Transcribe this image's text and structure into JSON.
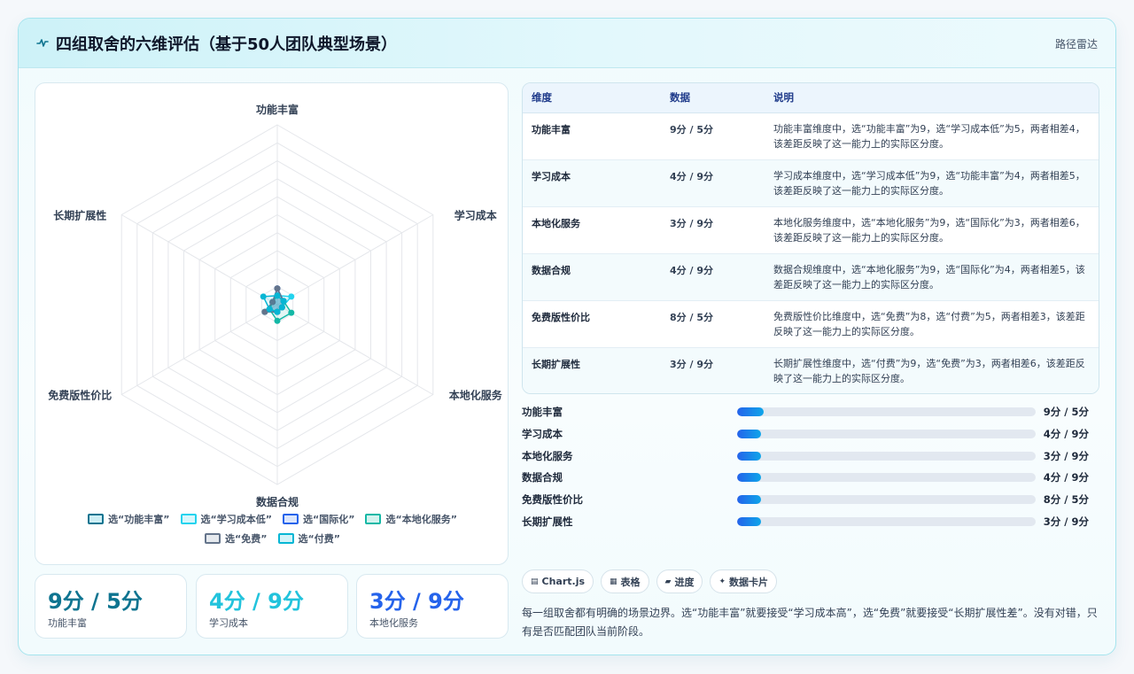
{
  "header": {
    "title": "四组取舍的六维评估（基于50人团队典型场景）",
    "badge": "路径雷达",
    "icon": "pulse-icon"
  },
  "chart_data": {
    "type": "radar",
    "axes": [
      "功能丰富",
      "学习成本",
      "本地化服务",
      "数据合规",
      "免费版性价比",
      "长期扩展性"
    ],
    "max": 100,
    "series": [
      {
        "name": "选“功能丰富”",
        "color": "#0e7490",
        "values": [
          9,
          4,
          3,
          4,
          8,
          3
        ]
      },
      {
        "name": "选“学习成本低”",
        "color": "#22d3ee",
        "values": [
          5,
          9,
          3,
          4,
          8,
          3
        ]
      },
      {
        "name": "选“国际化”",
        "color": "#2563eb",
        "values": [
          9,
          4,
          3,
          4,
          5,
          3
        ]
      },
      {
        "name": "选“本地化服务”",
        "color": "#14b8a6",
        "values": [
          5,
          4,
          9,
          9,
          5,
          3
        ]
      },
      {
        "name": "选“免费”",
        "color": "#64748b",
        "values": [
          9,
          4,
          3,
          4,
          8,
          3
        ]
      },
      {
        "name": "选“付费”",
        "color": "#06b6d4",
        "values": [
          5,
          4,
          3,
          4,
          5,
          9
        ]
      }
    ]
  },
  "stats": [
    {
      "value": "9分 / 5分",
      "label": "功能丰富",
      "color": "#0e7490"
    },
    {
      "value": "4分 / 9分",
      "label": "学习成本",
      "color": "#22c3dc"
    },
    {
      "value": "3分 / 9分",
      "label": "本地化服务",
      "color": "#2563eb"
    }
  ],
  "table": {
    "headers": [
      "维度",
      "数据",
      "说明"
    ],
    "rows": [
      [
        "功能丰富",
        "9分 / 5分",
        "功能丰富维度中，选“功能丰富”为9，选“学习成本低”为5，两者相差4，该差距反映了这一能力上的实际区分度。"
      ],
      [
        "学习成本",
        "4分 / 9分",
        "学习成本维度中，选“学习成本低”为9，选“功能丰富”为4，两者相差5，该差距反映了这一能力上的实际区分度。"
      ],
      [
        "本地化服务",
        "3分 / 9分",
        "本地化服务维度中，选“本地化服务”为9，选“国际化”为3，两者相差6，该差距反映了这一能力上的实际区分度。"
      ],
      [
        "数据合规",
        "4分 / 9分",
        "数据合规维度中，选“本地化服务”为9，选“国际化”为4，两者相差5，该差距反映了这一能力上的实际区分度。"
      ],
      [
        "免费版性价比",
        "8分 / 5分",
        "免费版性价比维度中，选“免费”为8，选“付费”为5，两者相差3，该差距反映了这一能力上的实际区分度。"
      ],
      [
        "长期扩展性",
        "3分 / 9分",
        "长期扩展性维度中，选“付费”为9，选“免费”为3，两者相差6，该差距反映了这一能力上的实际区分度。"
      ]
    ]
  },
  "progress": [
    {
      "label": "功能丰富",
      "value": "9分 / 5分",
      "fill": 0.09
    },
    {
      "label": "学习成本",
      "value": "4分 / 9分",
      "fill": 0.08
    },
    {
      "label": "本地化服务",
      "value": "3分 / 9分",
      "fill": 0.08
    },
    {
      "label": "数据合规",
      "value": "4分 / 9分",
      "fill": 0.08
    },
    {
      "label": "免费版性价比",
      "value": "8分 / 5分",
      "fill": 0.08
    },
    {
      "label": "长期扩展性",
      "value": "3分 / 9分",
      "fill": 0.08
    }
  ],
  "chips": [
    {
      "icon": "chart-icon",
      "label": "Chart.js"
    },
    {
      "icon": "table-icon",
      "label": "表格"
    },
    {
      "icon": "progress-icon",
      "label": "进度"
    },
    {
      "icon": "card-icon",
      "label": "数据卡片"
    }
  ],
  "note": "每一组取舍都有明确的场景边界。选“功能丰富”就要接受“学习成本高”，选“免费”就要接受“长期扩展性差”。没有对错，只有是否匹配团队当前阶段。"
}
